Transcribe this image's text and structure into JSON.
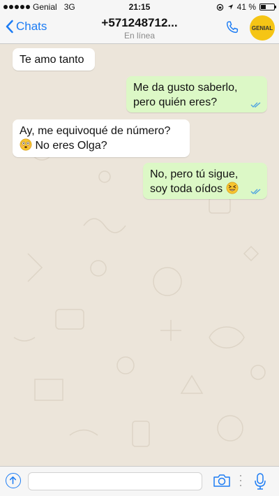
{
  "status_bar": {
    "carrier": "Genial",
    "network": "3G",
    "time": "21:15",
    "battery_text": "41 %",
    "battery_level": 0.41
  },
  "header": {
    "back_label": "Chats",
    "contact_name": "+571248712...",
    "contact_status": "En línea",
    "badge_text": "GENIAL",
    "badge_color": "#f5c515",
    "accent_color": "#1c7cf4"
  },
  "messages": [
    {
      "direction": "in",
      "lines": [
        "Te amo tanto"
      ]
    },
    {
      "direction": "out",
      "lines": [
        "Me da gusto saberlo,",
        "pero quién eres?"
      ],
      "status": "read-ticks-icon"
    },
    {
      "direction": "in",
      "lines": [
        "Ay, me equivoqué de número?",
        "No eres Olga?"
      ],
      "emoji": "flushed-face-icon"
    },
    {
      "direction": "out",
      "lines": [
        "No, pero tú sigue,",
        "soy toda oídos"
      ],
      "emoji": "laughing-face-icon",
      "status": "read-ticks-icon"
    }
  ],
  "colors": {
    "incoming_bubble": "#ffffff",
    "outgoing_bubble": "#dcf8c6",
    "chat_background": "#ece5da",
    "read_ticks": "#4fa3e0"
  },
  "input_bar": {
    "message_text": "",
    "icons": [
      "upload-icon",
      "camera-icon",
      "microphone-icon"
    ]
  }
}
